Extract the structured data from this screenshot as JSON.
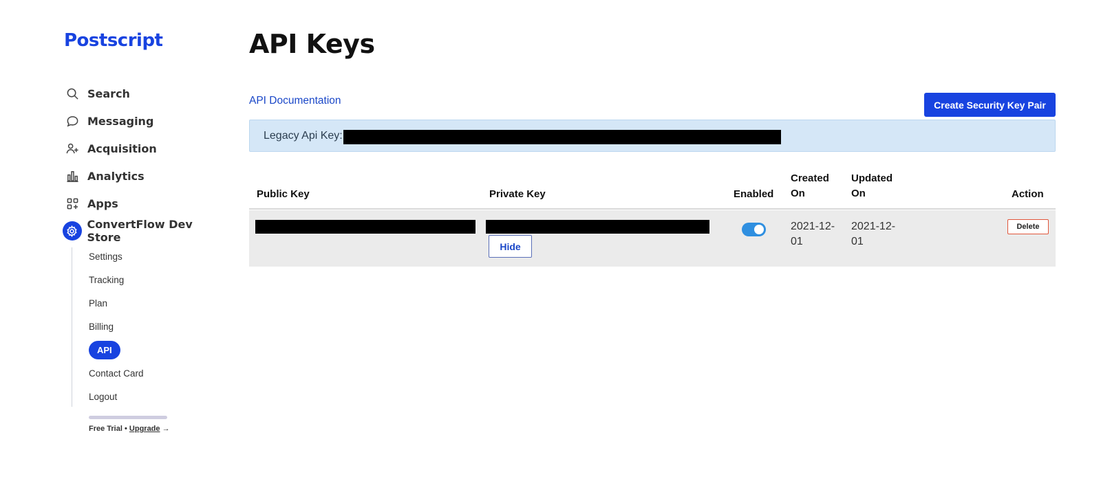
{
  "brand": {
    "logo_text": "Postscript",
    "color": "#1843e0"
  },
  "sidebar": {
    "items": [
      {
        "label": "Search",
        "icon": "search-icon"
      },
      {
        "label": "Messaging",
        "icon": "chat-bubble-icon"
      },
      {
        "label": "Acquisition",
        "icon": "user-add-icon"
      },
      {
        "label": "Analytics",
        "icon": "bar-chart-icon"
      },
      {
        "label": "Apps",
        "icon": "apps-grid-icon"
      },
      {
        "label": "ConvertFlow Dev Store",
        "icon": "gear-icon",
        "active": true
      }
    ],
    "subitems": [
      {
        "label": "Settings"
      },
      {
        "label": "Tracking"
      },
      {
        "label": "Plan"
      },
      {
        "label": "Billing"
      },
      {
        "label": "API",
        "active": true
      },
      {
        "label": "Contact Card"
      },
      {
        "label": "Logout"
      }
    ],
    "trial": {
      "status": "Free Trial",
      "separator": "•",
      "upgrade_label": "Upgrade",
      "arrow": "→"
    }
  },
  "main": {
    "title": "API Keys",
    "doc_link": "API Documentation",
    "create_button": "Create Security Key Pair",
    "legacy": {
      "label": "Legacy Api Key:"
    },
    "table": {
      "headers": {
        "public_key": "Public Key",
        "private_key": "Private Key",
        "enabled": "Enabled",
        "created_line1": "Created",
        "created_line2": "On",
        "updated_line1": "Updated",
        "updated_line2": "On",
        "action": "Action"
      },
      "rows": [
        {
          "enabled": true,
          "hide_label": "Hide",
          "created_line1": "2021-12-",
          "created_line2": "01",
          "updated_line1": "2021-12-",
          "updated_line2": "01",
          "delete_label": "Delete"
        }
      ]
    }
  }
}
